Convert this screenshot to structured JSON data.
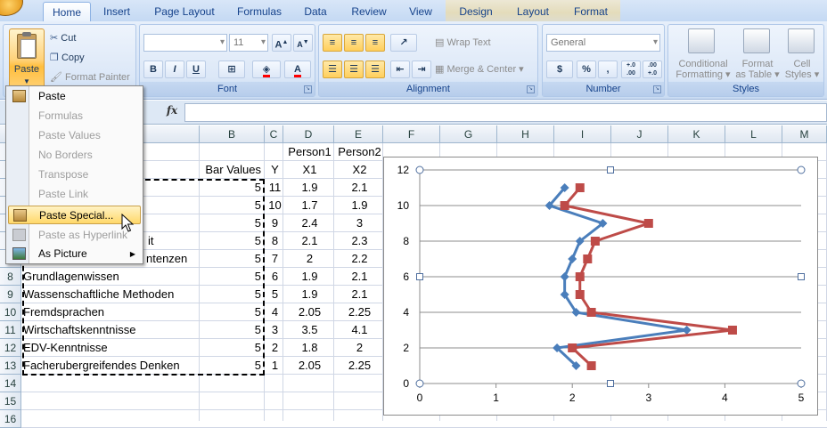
{
  "ribbon": {
    "tabs": [
      {
        "label": "Home",
        "active": true
      },
      {
        "label": "Insert"
      },
      {
        "label": "Page Layout"
      },
      {
        "label": "Formulas"
      },
      {
        "label": "Data"
      },
      {
        "label": "Review"
      },
      {
        "label": "View"
      },
      {
        "label": "Design",
        "contextual": true
      },
      {
        "label": "Layout",
        "contextual": true
      },
      {
        "label": "Format",
        "contextual": true
      }
    ],
    "clipboard": {
      "paste_label": "Paste",
      "cut_label": "Cut",
      "copy_label": "Copy",
      "format_painter_label": "Format Painter"
    },
    "font": {
      "group_label": "Font",
      "font_size": "11",
      "grow_label": "A",
      "shrink_label": "A",
      "bold": "B",
      "italic": "I",
      "underline": "U",
      "font_color_label": "A"
    },
    "alignment": {
      "group_label": "Alignment",
      "wrap_text_label": "Wrap Text",
      "merge_center_label": "Merge & Center"
    },
    "number": {
      "group_label": "Number",
      "format_value": "General",
      "currency": "$",
      "percent": "%",
      "comma": ",",
      "inc_decimal": "+.0 .00",
      "dec_decimal": ".00 +.0"
    },
    "styles": {
      "group_label": "Styles",
      "conditional_formatting": [
        "Conditional",
        "Formatting"
      ],
      "format_as_table": [
        "Format",
        "as Table"
      ],
      "cell_styles": [
        "Cell",
        "Styles"
      ]
    }
  },
  "formula_bar": {
    "fx_label": "fx",
    "value": ""
  },
  "context_menu": {
    "items": [
      {
        "label": "Paste",
        "disabled": false,
        "icon": "paste-icon"
      },
      {
        "label": "Formulas",
        "disabled": true
      },
      {
        "label": "Paste Values",
        "disabled": true
      },
      {
        "label": "No Borders",
        "disabled": true
      },
      {
        "label": "Transpose",
        "disabled": true
      },
      {
        "label": "Paste Link",
        "disabled": true
      },
      {
        "label": "Paste Special...",
        "disabled": false,
        "selected": true,
        "icon": "paste-special-icon"
      },
      {
        "label": "Paste as Hyperlink",
        "disabled": true,
        "icon": "hyperlink-icon"
      },
      {
        "label": "As Picture",
        "disabled": false,
        "submenu": true,
        "icon": "picture-icon"
      }
    ]
  },
  "sheet": {
    "columns": [
      "B",
      "C",
      "D",
      "E",
      "F",
      "G",
      "H",
      "I",
      "J",
      "K",
      "L",
      "M"
    ],
    "rows": [
      {
        "n": "",
        "a": "",
        "b": "",
        "c": "",
        "d": "Person1",
        "e": "Person2"
      },
      {
        "n": "",
        "a": "",
        "b": "Bar Values",
        "c": "Y",
        "d": "X1",
        "e": "X2"
      },
      {
        "n": "",
        "a": "",
        "b": "5",
        "c": "11",
        "d": "1.9",
        "e": "2.1"
      },
      {
        "n": "",
        "a": "",
        "b": "5",
        "c": "10",
        "d": "1.7",
        "e": "1.9"
      },
      {
        "n": "",
        "a": "",
        "b": "5",
        "c": "9",
        "d": "2.4",
        "e": "3"
      },
      {
        "n": "",
        "a": "it",
        "b": "5",
        "c": "8",
        "d": "2.1",
        "e": "2.3"
      },
      {
        "n": "",
        "a": "ntenzen",
        "b": "5",
        "c": "7",
        "d": "2",
        "e": "2.2"
      },
      {
        "n": "8",
        "a": "Grundlagenwissen",
        "b": "5",
        "c": "6",
        "d": "1.9",
        "e": "2.1"
      },
      {
        "n": "9",
        "a": "Wassenschaftliche Methoden",
        "b": "5",
        "c": "5",
        "d": "1.9",
        "e": "2.1"
      },
      {
        "n": "10",
        "a": "Fremdsprachen",
        "b": "5",
        "c": "4",
        "d": "2.05",
        "e": "2.25"
      },
      {
        "n": "11",
        "a": "Wirtschaftskenntnisse",
        "b": "5",
        "c": "3",
        "d": "3.5",
        "e": "4.1"
      },
      {
        "n": "12",
        "a": "EDV-Kenntnisse",
        "b": "5",
        "c": "2",
        "d": "1.8",
        "e": "2"
      },
      {
        "n": "13",
        "a": "Facherubergreifendes Denken",
        "b": "5",
        "c": "1",
        "d": "2.05",
        "e": "2.25"
      },
      {
        "n": "14",
        "a": "",
        "b": "",
        "c": "",
        "d": "",
        "e": ""
      },
      {
        "n": "15",
        "a": "",
        "b": "",
        "c": "",
        "d": "",
        "e": ""
      },
      {
        "n": "16",
        "a": "",
        "b": "",
        "c": "",
        "d": "",
        "e": ""
      }
    ]
  },
  "chart_data": {
    "type": "scatter",
    "title": "",
    "xlabel": "",
    "ylabel": "",
    "xlim": [
      0,
      5
    ],
    "ylim": [
      0,
      12
    ],
    "xticks": [
      "0",
      "1",
      "2",
      "3",
      "4",
      "5"
    ],
    "yticks": [
      "0",
      "2",
      "4",
      "6",
      "8",
      "10",
      "12"
    ],
    "grid": true,
    "series": [
      {
        "color": "#4a7ebb",
        "marker": "diamond",
        "x": [
          1.9,
          1.7,
          2.4,
          2.1,
          2.0,
          1.9,
          1.9,
          2.05,
          3.5,
          1.8,
          2.05
        ],
        "y": [
          11,
          10,
          9,
          8,
          7,
          6,
          5,
          4,
          3,
          2,
          1
        ]
      },
      {
        "color": "#be4b48",
        "marker": "square",
        "x": [
          2.1,
          1.9,
          3.0,
          2.3,
          2.2,
          2.1,
          2.1,
          2.25,
          4.1,
          2.0,
          2.25
        ],
        "y": [
          11,
          10,
          9,
          8,
          7,
          6,
          5,
          4,
          3,
          2,
          1
        ]
      }
    ]
  }
}
